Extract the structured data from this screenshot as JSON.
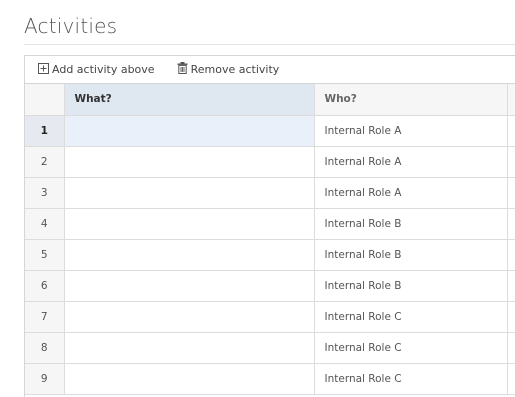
{
  "section": {
    "title": "Activities"
  },
  "toolbar": {
    "add_label": "Add activity above",
    "remove_label": "Remove activity"
  },
  "table": {
    "columns": [
      "What?",
      "Who?"
    ],
    "rows": [
      {
        "num": "1",
        "what": "",
        "who": "Internal Role A"
      },
      {
        "num": "2",
        "what": "",
        "who": "Internal Role A"
      },
      {
        "num": "3",
        "what": "",
        "who": "Internal Role A"
      },
      {
        "num": "4",
        "what": "",
        "who": "Internal Role B"
      },
      {
        "num": "5",
        "what": "",
        "who": "Internal Role B"
      },
      {
        "num": "6",
        "what": "",
        "who": "Internal Role B"
      },
      {
        "num": "7",
        "what": "",
        "who": "Internal Role C"
      },
      {
        "num": "8",
        "what": "",
        "who": "Internal Role C"
      },
      {
        "num": "9",
        "what": "",
        "who": "Internal Role C"
      }
    ],
    "selected_row": "1"
  },
  "icons": {
    "add": "plus-square-icon",
    "remove": "trash-icon"
  },
  "colors": {
    "header_bg": "#f6f6f6",
    "selected_header_bg": "#dfe7f1",
    "selected_cell_bg": "#e9f0fa",
    "grid_line": "#dcdcdc"
  }
}
